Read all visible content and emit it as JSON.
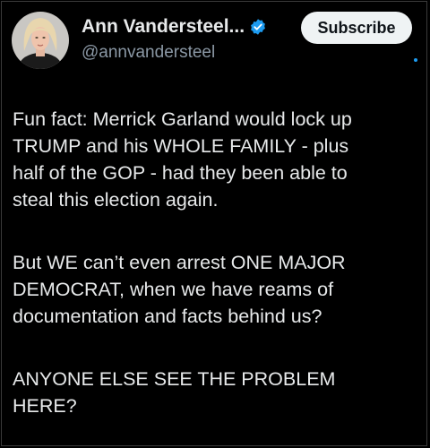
{
  "tweet": {
    "display_name": "Ann Vandersteel...",
    "handle": "@annvandersteel",
    "subscribe_label": "Subscribe",
    "paragraphs": [
      [
        "Fun fact: Merrick Garland would lock up",
        "TRUMP and his WHOLE FAMILY - plus",
        "half of the GOP - had they been able to",
        "steal this election again."
      ],
      [
        "But WE can’t even arrest ONE MAJOR",
        "DEMOCRAT, when we have reams of",
        "documentation and facts behind us?"
      ],
      [
        "ANYONE ELSE SEE THE PROBLEM",
        "HERE?"
      ]
    ]
  },
  "icons": {
    "verified": "verified-badge-icon",
    "avatar": "profile-photo"
  },
  "colors": {
    "background": "#000000",
    "text": "#e7e9ea",
    "handle": "#8b98a5",
    "verified": "#1d9bf0",
    "subscribe_bg": "#eff3f4"
  }
}
